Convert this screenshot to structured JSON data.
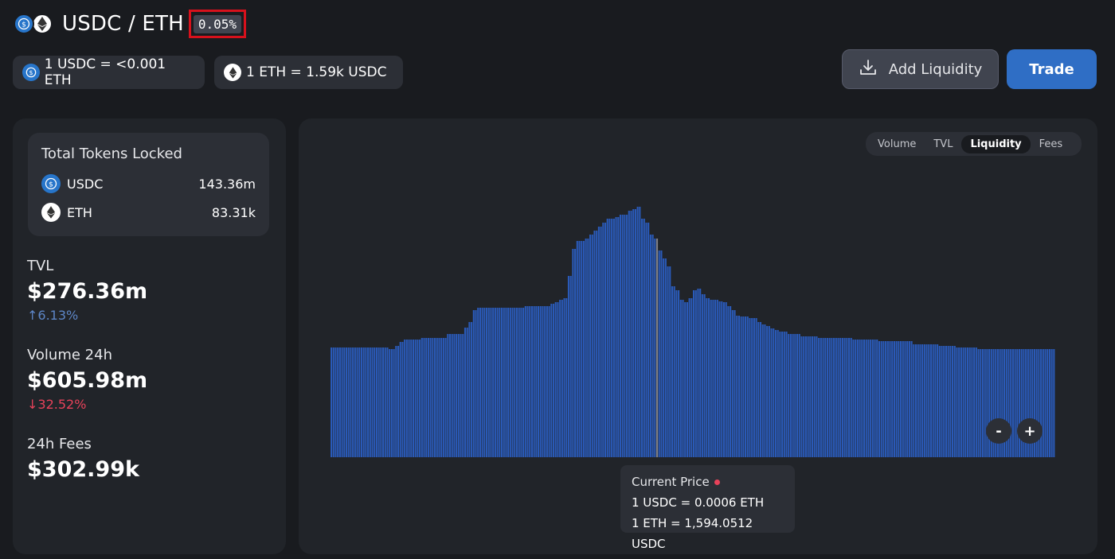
{
  "pair": {
    "title": "USDC / ETH",
    "fee_tier": "0.05%",
    "icons": [
      "usdc-token-icon",
      "eth-token-icon"
    ]
  },
  "prices": {
    "usdc_to_eth": "1 USDC = <0.001 ETH",
    "eth_to_usdc": "1 ETH = 1.59k USDC"
  },
  "actions": {
    "add_liquidity": "Add Liquidity",
    "trade": "Trade"
  },
  "locked": {
    "title": "Total Tokens Locked",
    "tokens": [
      {
        "symbol": "USDC",
        "amount": "143.36m"
      },
      {
        "symbol": "ETH",
        "amount": "83.31k"
      }
    ]
  },
  "stats": {
    "tvl": {
      "label": "TVL",
      "value": "$276.36m",
      "change": "6.13%",
      "direction": "up"
    },
    "volume": {
      "label": "Volume 24h",
      "value": "$605.98m",
      "change": "32.52%",
      "direction": "down"
    },
    "fees": {
      "label": "24h Fees",
      "value": "$302.99k"
    }
  },
  "chart_tabs": {
    "options": [
      "Volume",
      "TVL",
      "Liquidity",
      "Fees"
    ],
    "active": "Liquidity"
  },
  "zoom": {
    "out": "-",
    "in": "+"
  },
  "current_price": {
    "title": "Current Price",
    "usdc_line": "1 USDC = 0.0006 ETH",
    "eth_line": "1 ETH = 1,594.0512 USDC"
  },
  "colors": {
    "background": "#191b1f",
    "panel": "#212429",
    "card": "#2c2f36",
    "bar": "#2a5ab8",
    "trade_button": "#2f6ec5",
    "highlight_border": "#d7111c",
    "up": "#5d86c7",
    "down": "#e8425a"
  },
  "chart_data": {
    "type": "bar",
    "series": [
      {
        "values": [
          138,
          138,
          138,
          138,
          138,
          138,
          138,
          138,
          138,
          138,
          138,
          138,
          138,
          138,
          138,
          138,
          138,
          138,
          138,
          138,
          138,
          138,
          138,
          138,
          138,
          138,
          138,
          136,
          136,
          136,
          140,
          140,
          145,
          145,
          148,
          148,
          148,
          148,
          148,
          148,
          148,
          148,
          150,
          150,
          150,
          150,
          150,
          150,
          150,
          150,
          150,
          150,
          150,
          150,
          155,
          155,
          155,
          155,
          155,
          155,
          155,
          155,
          163,
          163,
          170,
          170,
          185,
          185,
          188,
          188,
          188,
          188,
          188,
          188,
          188,
          188,
          188,
          188,
          188,
          188,
          188,
          188,
          188,
          188,
          188,
          188,
          188,
          188,
          188,
          188,
          190,
          190,
          190,
          190,
          190,
          190,
          190,
          190,
          190,
          190,
          190,
          190,
          193,
          193,
          195,
          195,
          198,
          198,
          200,
          200,
          228,
          228,
          262,
          262,
          272,
          272,
          272,
          272,
          275,
          275,
          280,
          280,
          285,
          285,
          290,
          290,
          295,
          295,
          300,
          300,
          300,
          300,
          302,
          302,
          305,
          305,
          305,
          305,
          310,
          310,
          312,
          312,
          315,
          315,
          300,
          300,
          295,
          295,
          280,
          280,
          275,
          275,
          260,
          260,
          250,
          250,
          240,
          240,
          215,
          215,
          210,
          210,
          198,
          198,
          195,
          195,
          200,
          200,
          210,
          210,
          212,
          212,
          205,
          205,
          200,
          200,
          198,
          198,
          198,
          198,
          196,
          196,
          195,
          195,
          190,
          190,
          185,
          185,
          178,
          178,
          177,
          177,
          177,
          177,
          175,
          175,
          175,
          175,
          170,
          170,
          167,
          167,
          165,
          165,
          162,
          162,
          160,
          160,
          158,
          158,
          158,
          158,
          155,
          155,
          155,
          155,
          155,
          155,
          152,
          152,
          152,
          152,
          152,
          152,
          152,
          152,
          150,
          150,
          150,
          150,
          150,
          150,
          150,
          150,
          150,
          150,
          150,
          150,
          150,
          150,
          150,
          150,
          148,
          148,
          148,
          148,
          148,
          148,
          148,
          148,
          148,
          148,
          148,
          148,
          146,
          146,
          146,
          146,
          146,
          146,
          146,
          146,
          146,
          146,
          146,
          146,
          146,
          146,
          146,
          146,
          142,
          142,
          142,
          142,
          142,
          142,
          142,
          142,
          142,
          142,
          142,
          142,
          140,
          140,
          140,
          140,
          140,
          140,
          140,
          140,
          138,
          138,
          138,
          138,
          138,
          138,
          138,
          138,
          138,
          138,
          136,
          136,
          136,
          136,
          136,
          136,
          136,
          136,
          136,
          136,
          136,
          136,
          136,
          136,
          136,
          136,
          136,
          136,
          136,
          136,
          136,
          136,
          136,
          136,
          136,
          136,
          136,
          136,
          136,
          136,
          136,
          136,
          136,
          136,
          136,
          136
        ]
      }
    ],
    "current_price_bar_index": 151,
    "ylim": [
      0,
      320
    ]
  }
}
